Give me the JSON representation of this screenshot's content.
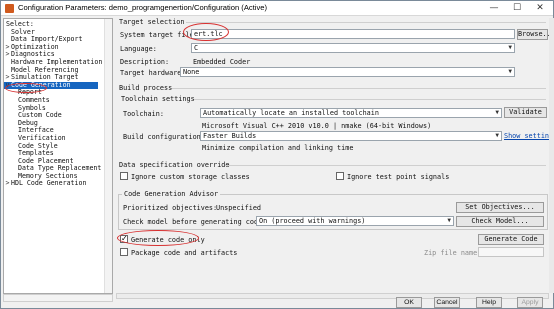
{
  "window": {
    "title": "Configuration Parameters: demo_programgenertion/Configuration (Active)",
    "minimize": "—",
    "maximize": "☐",
    "close": "✕"
  },
  "tree": {
    "header": "Select:",
    "items": [
      {
        "label": "Solver",
        "level": 0
      },
      {
        "label": "Data Import/Export",
        "level": 0
      },
      {
        "label": "Optimization",
        "level": 0,
        "toggle": ">"
      },
      {
        "label": "Diagnostics",
        "level": 0,
        "toggle": ">"
      },
      {
        "label": "Hardware Implementation",
        "level": 0
      },
      {
        "label": "Model Referencing",
        "level": 0
      },
      {
        "label": "Simulation Target",
        "level": 0,
        "toggle": ">"
      },
      {
        "label": "Code Generation",
        "level": 0,
        "toggle": "v",
        "selected": true
      },
      {
        "label": "Report",
        "level": 1
      },
      {
        "label": "Comments",
        "level": 1
      },
      {
        "label": "Symbols",
        "level": 1
      },
      {
        "label": "Custom Code",
        "level": 1
      },
      {
        "label": "Debug",
        "level": 1
      },
      {
        "label": "Interface",
        "level": 1
      },
      {
        "label": "Verification",
        "level": 1
      },
      {
        "label": "Code Style",
        "level": 1
      },
      {
        "label": "Templates",
        "level": 1
      },
      {
        "label": "Code Placement",
        "level": 1
      },
      {
        "label": "Data Type Replacement",
        "level": 1
      },
      {
        "label": "Memory Sections",
        "level": 1
      },
      {
        "label": "HDL Code Generation",
        "level": 0,
        "toggle": ">"
      }
    ]
  },
  "target_selection": {
    "title": "Target selection",
    "system_target_label": "System target file:",
    "system_target_value": "ert.tlc",
    "browse_label": "Browse...",
    "language_label": "Language:",
    "language_value": "C",
    "description_label": "Description:",
    "description_value": "Embedded Coder",
    "hardware_label": "Target hardware:",
    "hardware_value": "None"
  },
  "build_process": {
    "title": "Build process",
    "toolchain_settings_title": "Toolchain settings",
    "toolchain_label": "Toolchain:",
    "toolchain_value": "Automatically locate an installed toolchain",
    "validate_label": "Validate",
    "toolchain_info": "Microsoft Visual C++ 2010 v10.0 | nmake (64-bit Windows)",
    "build_config_label": "Build configuration:",
    "build_config_value": "Faster Builds",
    "show_settings_label": "Show settings",
    "build_config_info": "Minimize compilation and linking time"
  },
  "data_spec": {
    "title": "Data specification override",
    "ignore_storage_label": "Ignore custom storage classes",
    "ignore_storage_checked": false,
    "ignore_test_label": "Ignore test point signals",
    "ignore_test_checked": false
  },
  "advisor": {
    "title": "Code Generation Advisor",
    "objectives_label": "Prioritized objectives:",
    "objectives_value": "Unspecified",
    "set_objectives_label": "Set Objectives...",
    "check_label": "Check model before generating code:",
    "check_value": "On (proceed with warnings)",
    "check_model_label": "Check Model..."
  },
  "generate": {
    "generate_only_label": "Generate code only",
    "generate_only_checked": true,
    "generate_button_label": "Generate Code",
    "package_label": "Package code and artifacts",
    "package_checked": false,
    "zip_label": "Zip file name:",
    "zip_value": ""
  },
  "footer": {
    "ok_label": "OK",
    "cancel_label": "Cancel",
    "help_label": "Help",
    "apply_label": "Apply"
  },
  "colors": {
    "selection": "#1565c0",
    "annotation": "#d73030",
    "link": "#0645ad"
  }
}
